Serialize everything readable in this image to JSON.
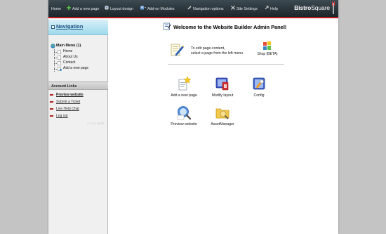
{
  "topbar": {
    "items": [
      {
        "label": "Home"
      },
      {
        "label": "Add a new page"
      },
      {
        "label": "Layout design"
      },
      {
        "label": "Add-on Modules"
      },
      {
        "label": "Navigation options"
      },
      {
        "label": "Site Settings"
      },
      {
        "label": "Help"
      }
    ],
    "logo_bold": "Bistro",
    "logo_light": "Square"
  },
  "sidebar": {
    "heading": "Navigation",
    "tree_root": "Main Menu (1)",
    "tree_items": [
      {
        "label": "Home"
      },
      {
        "label": "About Us"
      },
      {
        "label": "Contact"
      },
      {
        "label": "Add a new page"
      }
    ],
    "account_heading": "Account Links",
    "account_links": [
      {
        "label": "Preview website"
      },
      {
        "label": "Submit a Ticket"
      },
      {
        "label": "Live Help Chat"
      },
      {
        "label": "Log out"
      }
    ],
    "version": "v. 1.11. 20051"
  },
  "main": {
    "title": "Welcome to the Website Builder Admin Panel!",
    "info_line1": "To edit page-content,",
    "info_line2": "select a page from the left menu",
    "shop_label": "Shop (BETA)",
    "tiles": [
      {
        "label": "Add a new page",
        "icon": "add-page-icon"
      },
      {
        "label": "Modify layout",
        "icon": "modify-layout-icon"
      },
      {
        "label": "Config",
        "icon": "config-icon"
      },
      {
        "label": "Preview website",
        "icon": "preview-icon"
      },
      {
        "label": "AssetManager",
        "icon": "asset-manager-icon"
      }
    ]
  },
  "colors": {
    "topbar_bg": "#2a353b",
    "accent_red": "#b21a1a",
    "sidebar_head": "#9fd9ec",
    "link_blue": "#1d4f80"
  }
}
